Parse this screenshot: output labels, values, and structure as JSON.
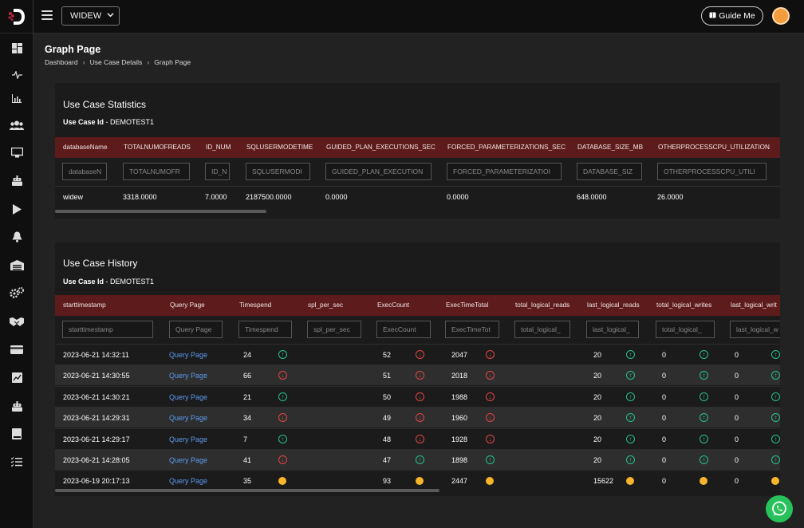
{
  "topbar": {
    "db_select": "WIDEW",
    "guide_label": "Guide Me"
  },
  "page": {
    "title": "Graph Page",
    "breadcrumb": [
      "Dashboard",
      "Use Case Details",
      "Graph Page"
    ]
  },
  "stats": {
    "title": "Use Case Statistics",
    "id_label": "Use Case Id",
    "id_value": " - DEMOTEST1",
    "columns": [
      {
        "header": "databaseName",
        "placeholder": "databaseN",
        "value": "widew"
      },
      {
        "header": "TOTALNUMOFREADS",
        "placeholder": "TOTALNUMOFR",
        "value": "3318.0000"
      },
      {
        "header": "ID_NUM",
        "placeholder": "ID_N",
        "value": "7.0000"
      },
      {
        "header": "SQLUSERMODETIME",
        "placeholder": "SQLUSERMODI",
        "value": "2187500.0000"
      },
      {
        "header": "GUIDED_PLAN_EXECUTIONS_SEC",
        "placeholder": "GUIDED_PLAN_EXECUTION",
        "value": "0.0000"
      },
      {
        "header": "FORCED_PARAMETERIZATIONS_SEC",
        "placeholder": "FORCED_PARAMETERIZATIOI",
        "value": "0.0000"
      },
      {
        "header": "DATABASE_SIZE_MB",
        "placeholder": "DATABASE_SIZ",
        "value": "648.0000"
      },
      {
        "header": "OTHERPROCESSCPU_UTILIZATION",
        "placeholder": "OTHERPROCESSCPU_UTILI",
        "value": "26.0000"
      }
    ]
  },
  "history": {
    "title": "Use Case History",
    "id_label": "Use Case Id",
    "id_value": " - DEMOTEST1",
    "headers": [
      "starttimestamp",
      "Query Page",
      "Timespend",
      "spl_per_sec",
      "ExecCount",
      "ExecTimeTotal",
      "total_logical_reads",
      "last_logical_reads",
      "total_logical_writes",
      "last_logical_writ"
    ],
    "placeholders": [
      "starttimestamp",
      "Query Page",
      "Timespend",
      "spl_per_sec",
      "ExecCount",
      "ExecTimeTot",
      "total_logical_",
      "last_logical_",
      "total_logical_",
      "last_logical_w"
    ],
    "rows": [
      {
        "ts": "2023-06-21 14:32:11",
        "link": "Query Page",
        "timespend": "24",
        "t_ind": "up",
        "exec": "52",
        "e_ind": "down",
        "ett": "2047",
        "ett_ind": "down",
        "llr": "20",
        "llr_ind": "up",
        "tlw": "0",
        "tlw_ind": "up",
        "llw": "0",
        "llw_ind": "up"
      },
      {
        "ts": "2023-06-21 14:30:55",
        "link": "Query Page",
        "timespend": "66",
        "t_ind": "down",
        "exec": "51",
        "e_ind": "down",
        "ett": "2018",
        "ett_ind": "down",
        "llr": "20",
        "llr_ind": "up",
        "tlw": "0",
        "tlw_ind": "up",
        "llw": "0",
        "llw_ind": "up"
      },
      {
        "ts": "2023-06-21 14:30:21",
        "link": "Query Page",
        "timespend": "21",
        "t_ind": "up",
        "exec": "50",
        "e_ind": "down",
        "ett": "1988",
        "ett_ind": "down",
        "llr": "20",
        "llr_ind": "up",
        "tlw": "0",
        "tlw_ind": "up",
        "llw": "0",
        "llw_ind": "up"
      },
      {
        "ts": "2023-06-21 14:29:31",
        "link": "Query Page",
        "timespend": "34",
        "t_ind": "down",
        "exec": "49",
        "e_ind": "down",
        "ett": "1960",
        "ett_ind": "down",
        "llr": "20",
        "llr_ind": "up",
        "tlw": "0",
        "tlw_ind": "up",
        "llw": "0",
        "llw_ind": "up"
      },
      {
        "ts": "2023-06-21 14:29:17",
        "link": "Query Page",
        "timespend": "7",
        "t_ind": "up",
        "exec": "48",
        "e_ind": "down",
        "ett": "1928",
        "ett_ind": "down",
        "llr": "20",
        "llr_ind": "up",
        "tlw": "0",
        "tlw_ind": "up",
        "llw": "0",
        "llw_ind": "up"
      },
      {
        "ts": "2023-06-21 14:28:05",
        "link": "Query Page",
        "timespend": "41",
        "t_ind": "down",
        "exec": "47",
        "e_ind": "up",
        "ett": "1898",
        "ett_ind": "up",
        "llr": "20",
        "llr_ind": "up",
        "tlw": "0",
        "tlw_ind": "up",
        "llw": "0",
        "llw_ind": "up"
      },
      {
        "ts": "2023-06-19 20:17:13",
        "link": "Query Page",
        "timespend": "35",
        "t_ind": "dot",
        "exec": "93",
        "e_ind": "dot",
        "ett": "2447",
        "ett_ind": "dot",
        "llr": "15622",
        "llr_ind": "dot",
        "tlw": "0",
        "tlw_ind": "dot",
        "llw": "0",
        "llw_ind": "dot"
      }
    ]
  },
  "colors": {
    "header_bg": "#5e1b1b",
    "up": "#25c08a",
    "down": "#e24545",
    "neutral": "#f7b52b",
    "link": "#5b9bf0"
  },
  "sidebar_icons": [
    "dashboard-icon",
    "pulse-icon",
    "bar-chart-icon",
    "users-icon",
    "monitor-icon",
    "bot-icon",
    "play-icon",
    "bell-icon",
    "warehouse-icon",
    "gears-icon",
    "handshake-icon",
    "card-icon",
    "image-chart-icon",
    "bot-alt-icon",
    "book-icon",
    "checklist-icon"
  ]
}
